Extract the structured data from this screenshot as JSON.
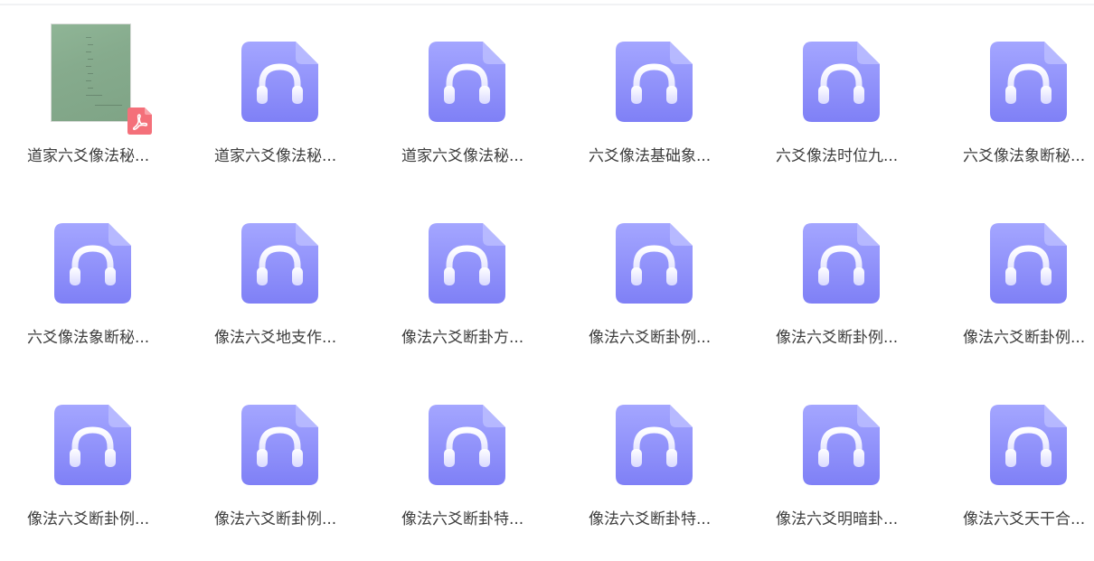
{
  "files": [
    {
      "name": "道家六爻像法秘...",
      "type": "pdf"
    },
    {
      "name": "道家六爻像法秘...",
      "type": "audio"
    },
    {
      "name": "道家六爻像法秘...",
      "type": "audio"
    },
    {
      "name": "六爻像法基础象...",
      "type": "audio"
    },
    {
      "name": "六爻像法时位九...",
      "type": "audio"
    },
    {
      "name": "六爻像法象断秘...",
      "type": "audio"
    },
    {
      "name": "六爻像法象断秘...",
      "type": "audio"
    },
    {
      "name": "像法六爻地支作...",
      "type": "audio"
    },
    {
      "name": "像法六爻断卦方...",
      "type": "audio"
    },
    {
      "name": "像法六爻断卦例...",
      "type": "audio"
    },
    {
      "name": "像法六爻断卦例...",
      "type": "audio"
    },
    {
      "name": "像法六爻断卦例...",
      "type": "audio"
    },
    {
      "name": "像法六爻断卦例...",
      "type": "audio"
    },
    {
      "name": "像法六爻断卦例...",
      "type": "audio"
    },
    {
      "name": "像法六爻断卦特...",
      "type": "audio"
    },
    {
      "name": "像法六爻断卦特...",
      "type": "audio"
    },
    {
      "name": "像法六爻明暗卦...",
      "type": "audio"
    },
    {
      "name": "像法六爻天干合...",
      "type": "audio"
    }
  ],
  "icons": {
    "audio": "headphones-audio-file-icon",
    "pdf": "pdf-file-icon"
  },
  "colors": {
    "audio_icon_top": "#a4a6ff",
    "audio_icon_bottom": "#7f80f6",
    "pdf_badge": "#f4707a",
    "text": "#3d3d3d"
  }
}
